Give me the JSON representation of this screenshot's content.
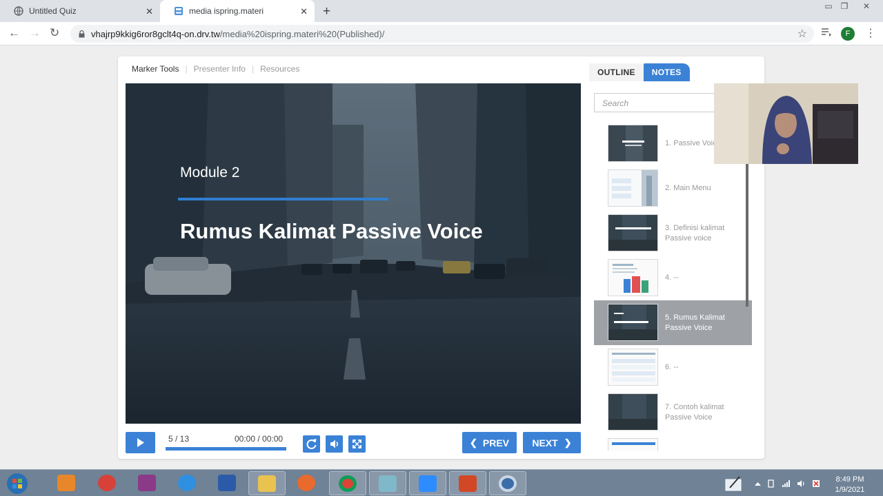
{
  "browser": {
    "tabs": [
      {
        "title": "Untitled Quiz",
        "active": false
      },
      {
        "title": "media ispring.materi",
        "active": true
      }
    ],
    "url_host": "vhajrp9kkig6ror8gclt4q-on.drv.tw",
    "url_path": "/media%20ispring.materi%20(Published)/",
    "profile_initial": "F"
  },
  "player": {
    "top_nav": [
      "Marker Tools",
      "Presenter Info",
      "Resources"
    ],
    "slide": {
      "module": "Module 2",
      "title": "Rumus Kalimat Passive Voice"
    },
    "controls": {
      "counter": "5 / 13",
      "time": "00:00 / 00:00",
      "prev_label": "PREV",
      "next_label": "NEXT"
    },
    "sidebar": {
      "tabs": [
        "OUTLINE",
        "NOTES"
      ],
      "active_tab": "NOTES",
      "search_placeholder": "Search",
      "items": [
        {
          "label": "1. Passive Voice"
        },
        {
          "label": "2. Main Menu"
        },
        {
          "label": "3. Definisi kalimat Passive voice"
        },
        {
          "label": "4. --"
        },
        {
          "label": "5. Rumus Kalimat Passive Voice",
          "current": true
        },
        {
          "label": "6. --"
        },
        {
          "label": "7. Contoh kalimat Passive Voice"
        }
      ]
    }
  },
  "taskbar": {
    "time": "8:49 PM",
    "date": "1/9/2021"
  },
  "colors": {
    "accent": "#3b82d6",
    "current_item_bg": "#9ea2a7"
  }
}
